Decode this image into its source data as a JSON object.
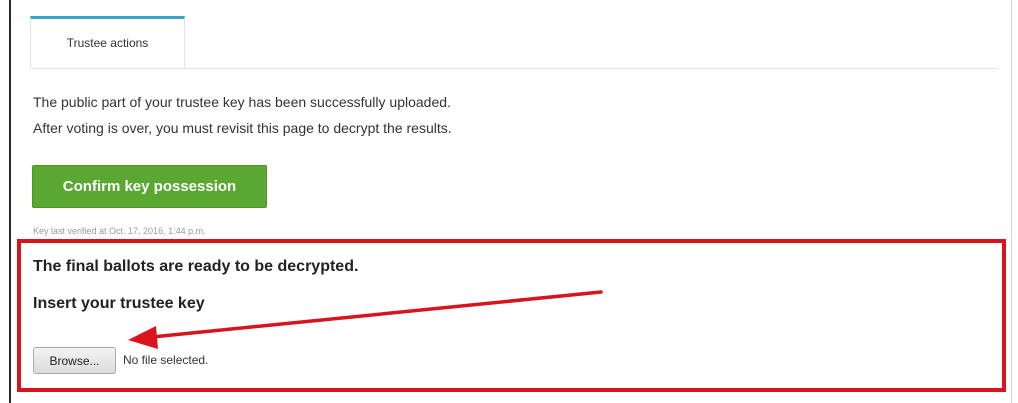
{
  "tabs": [
    {
      "label": "Trustee actions"
    }
  ],
  "info": {
    "line1": "The public part of your trustee key has been successfully uploaded.",
    "line2": "After voting is over, you must revisit this page to decrypt the results."
  },
  "confirm_button": {
    "label": "Confirm key possession"
  },
  "verification": {
    "note": "Key last verified at Oct. 17, 2016, 1:44 p.m."
  },
  "decrypt_panel": {
    "title": "The final ballots are ready to be decrypted.",
    "subtitle": "Insert your trustee key",
    "browse_label": "Browse...",
    "file_status": "No file selected."
  },
  "colors": {
    "tab_accent": "#3ba3c9",
    "confirm_green": "#5aa832",
    "annotation_red": "#d8141c"
  }
}
